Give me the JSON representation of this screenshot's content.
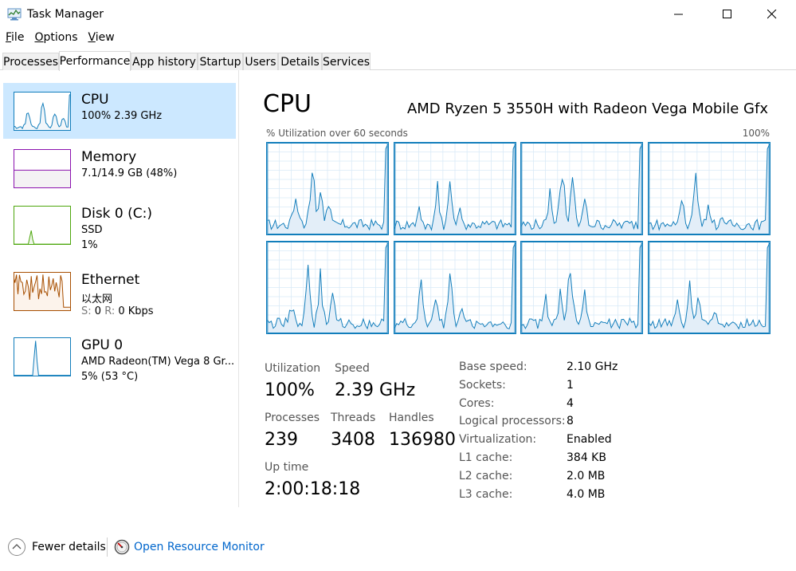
{
  "window": {
    "title": "Task Manager",
    "icons": {
      "app": "task-manager-icon",
      "minimize": "minimize-icon",
      "maximize": "maximize-icon",
      "close": "close-icon"
    }
  },
  "menu": [
    {
      "label": "File",
      "key": "F",
      "rest": "ile"
    },
    {
      "label": "Options",
      "key": "O",
      "rest": "ptions"
    },
    {
      "label": "View",
      "key": "V",
      "rest": "iew"
    }
  ],
  "tabs": [
    "Processes",
    "Performance",
    "App history",
    "Startup",
    "Users",
    "Details",
    "Services"
  ],
  "active_tab": "Performance",
  "sidebar": [
    {
      "title": "CPU",
      "line1": "100% 2.39 GHz",
      "line2": "",
      "color": "#117dbb",
      "fill": "#f1f6fa"
    },
    {
      "title": "Memory",
      "line1": "7.1/14.9 GB (48%)",
      "line2": "",
      "color": "#8b12ae",
      "fill": "#f4f2f4"
    },
    {
      "title": "Disk 0 (C:)",
      "line1": "SSD",
      "line2": "1%",
      "color": "#4da60c",
      "fill": "#eff7ea"
    },
    {
      "title": "Ethernet",
      "line1": "以太网",
      "line2_parts": {
        "s_label": "S:",
        "s_value": "0",
        "r_label": "R:",
        "r_value": "0 Kbps"
      },
      "color": "#a74f01",
      "fill": "#fcf3eb"
    },
    {
      "title": "GPU 0",
      "line1": "AMD Radeon(TM) Vega 8 Gr...",
      "line2": "5% (53 °C)",
      "color": "#117dbb",
      "fill": "#f1f6fa"
    }
  ],
  "main": {
    "title": "CPU",
    "cpu_name": "AMD Ryzen 5 3550H with Radeon Vega Mobile Gfx",
    "util_label": "% Utilization over 60 seconds",
    "util_max": "100%",
    "graph_color": "#117dbb",
    "stats": {
      "utilization_label": "Utilization",
      "utilization": "100%",
      "speed_label": "Speed",
      "speed": "2.39 GHz",
      "processes_label": "Processes",
      "processes": "239",
      "threads_label": "Threads",
      "threads": "3408",
      "handles_label": "Handles",
      "handles": "136980",
      "uptime_label": "Up time",
      "uptime": "2:00:18:18"
    },
    "specs": [
      {
        "label": "Base speed:",
        "value": "2.10 GHz"
      },
      {
        "label": "Sockets:",
        "value": "1"
      },
      {
        "label": "Cores:",
        "value": "4"
      },
      {
        "label": "Logical processors:",
        "value": "8"
      },
      {
        "label": "Virtualization:",
        "value": "Enabled"
      },
      {
        "label": "L1 cache:",
        "value": "384 KB"
      },
      {
        "label": "L2 cache:",
        "value": "2.0 MB"
      },
      {
        "label": "L3 cache:",
        "value": "4.0 MB"
      }
    ]
  },
  "footer": {
    "fewer_details": "Fewer details",
    "open_resource_monitor": "Open Resource Monitor",
    "icons": {
      "fewer": "chevron-up-icon",
      "monitor": "resource-monitor-icon"
    }
  }
}
